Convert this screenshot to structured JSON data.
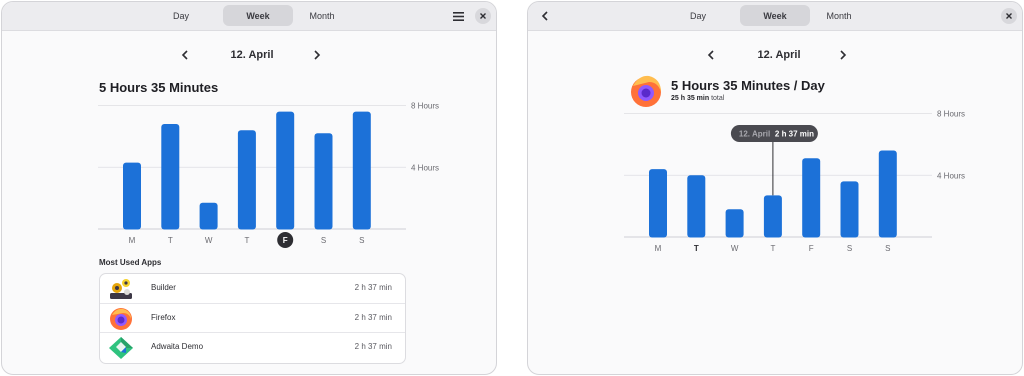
{
  "colors": {
    "bar": "#1c71d8",
    "grid": "#dedee2",
    "axis": "#cfcfd4",
    "tooltip_bg": "#4a4a50",
    "selected_day_bg": "#2e2e33"
  },
  "window1": {
    "tabs": [
      {
        "label": "Day",
        "active": false
      },
      {
        "label": "Week",
        "active": true
      },
      {
        "label": "Month",
        "active": false
      }
    ],
    "menu_icon": "hamburger-menu-icon",
    "close_icon": "close-icon",
    "date": "12. April",
    "total": "5 Hours 35 Minutes",
    "most_used_title": "Most Used Apps",
    "apps": [
      {
        "name": "Builder",
        "time": "2 h 37 min",
        "icon": "builder-icon"
      },
      {
        "name": "Firefox",
        "time": "2 h 37 min",
        "icon": "firefox-icon"
      },
      {
        "name": "Adwaita Demo",
        "time": "2 h 37 min",
        "icon": "adwaita-demo-icon"
      }
    ]
  },
  "window2": {
    "tabs": [
      {
        "label": "Day",
        "active": false
      },
      {
        "label": "Week",
        "active": true
      },
      {
        "label": "Month",
        "active": false
      }
    ],
    "back_icon": "back-arrow-icon",
    "close_icon": "close-icon",
    "date": "12. April",
    "app_icon": "firefox-icon",
    "title": "5 Hours 35 Minutes / Day",
    "total_value": "25 h 35 min",
    "total_suffix": "total",
    "tooltip": {
      "date": "12. April",
      "value": "2 h 37 min"
    }
  },
  "chart_data": [
    {
      "type": "bar",
      "categories": [
        "M",
        "T",
        "W",
        "T",
        "F",
        "S",
        "S"
      ],
      "values": [
        4.3,
        6.8,
        1.7,
        6.4,
        7.6,
        6.2,
        7.6
      ],
      "y_ticks": [
        {
          "value": 8,
          "label": "8 Hours"
        },
        {
          "value": 4,
          "label": "4 Hours"
        }
      ],
      "ylim": [
        0,
        8
      ],
      "selected_index": 4,
      "grid": true
    },
    {
      "type": "bar",
      "categories": [
        "M",
        "T",
        "W",
        "T",
        "F",
        "S",
        "S"
      ],
      "values": [
        4.4,
        4.0,
        1.8,
        2.7,
        5.1,
        3.6,
        5.6
      ],
      "y_ticks": [
        {
          "value": 8,
          "label": "8 Hours"
        },
        {
          "value": 4,
          "label": "4 Hours"
        }
      ],
      "ylim": [
        0,
        8
      ],
      "bold_index": 1,
      "tooltip_index": 3,
      "grid": true
    }
  ]
}
